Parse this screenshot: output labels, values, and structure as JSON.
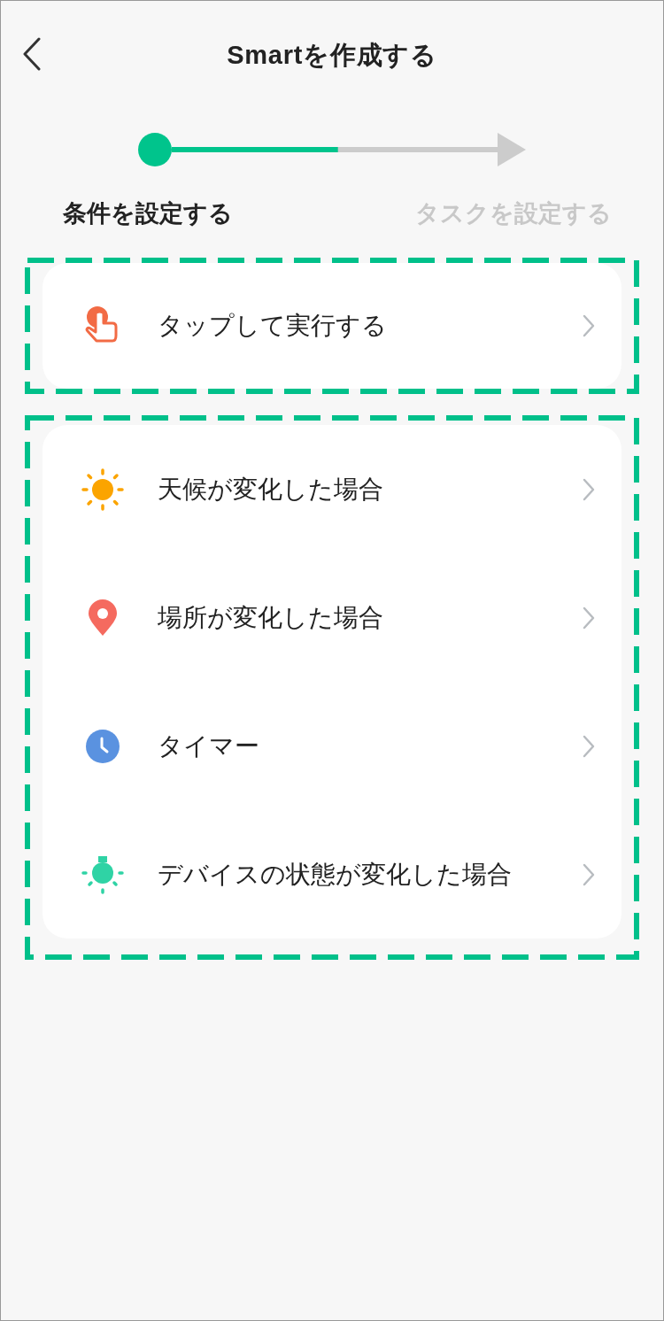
{
  "header": {
    "title": "Smartを作成する"
  },
  "progress": {
    "level": 0.51
  },
  "steps": [
    {
      "label": "条件を設定する",
      "selected": true
    },
    {
      "label": "タスクを設定する",
      "selected": false
    }
  ],
  "groups": [
    {
      "highlighted": true,
      "items": [
        {
          "kind": "tap",
          "label": "タップして実行する"
        }
      ]
    },
    {
      "highlighted": true,
      "items": [
        {
          "kind": "weather",
          "label": "天候が変化した場合"
        },
        {
          "kind": "location",
          "label": "場所が変化した場合"
        },
        {
          "kind": "timer",
          "label": "タイマー"
        },
        {
          "kind": "device",
          "label": "デバイスの状態が変化した場合"
        }
      ]
    }
  ]
}
